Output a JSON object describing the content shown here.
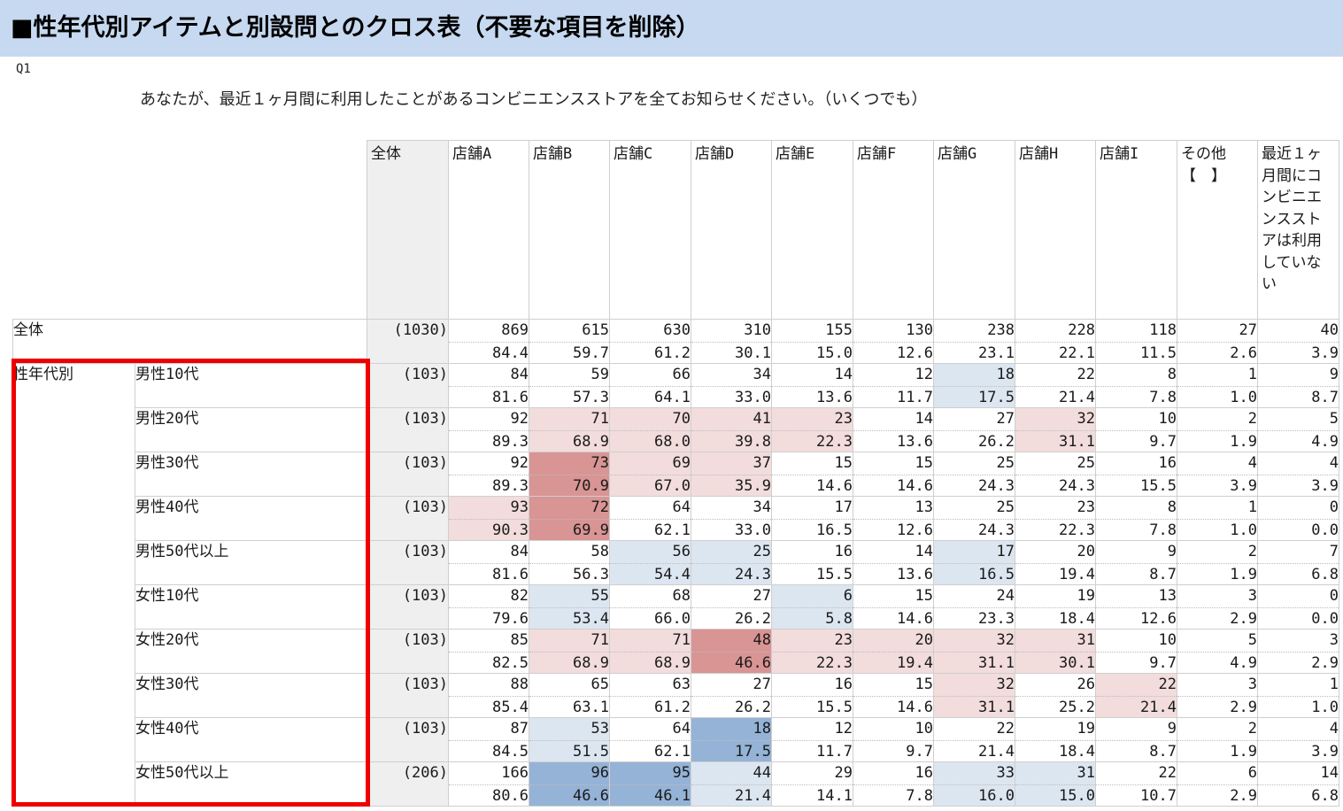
{
  "title": "■性年代別アイテムと別設問とのクロス表（不要な項目を削除）",
  "question_id": "Q1",
  "question_text": "あなたが、最近１ヶ月間に利用したことがあるコンビニエンスストアを全てお知らせください。（いくつでも）",
  "columns": [
    "全体",
    "店舗A",
    "店舗B",
    "店舗C",
    "店舗D",
    "店舗E",
    "店舗F",
    "店舗G",
    "店舗H",
    "店舗I",
    "その他【　】",
    "最近１ヶ月間にコンビニエンスストアは利用していない"
  ],
  "colors": {
    "title_bg": "#c6d9f0",
    "n_bg": "#efefef",
    "highlight_frame": "#ee0000",
    "r1": "#f2dcdc",
    "r2": "#d99494",
    "b1": "#dce6f1",
    "b2": "#95b3d7"
  },
  "rows": [
    {
      "group": "全体",
      "label": "",
      "n": "(1030)",
      "counts": [
        "869",
        "615",
        "630",
        "310",
        "155",
        "130",
        "238",
        "228",
        "118",
        "27",
        "40"
      ],
      "pcts": [
        "84.4",
        "59.7",
        "61.2",
        "30.1",
        "15.0",
        "12.6",
        "23.1",
        "22.1",
        "11.5",
        "2.6",
        "3.9"
      ],
      "shade": [
        "",
        "",
        "",
        "",
        "",
        "",
        "",
        "",
        "",
        "",
        ""
      ]
    },
    {
      "group": "性年代別",
      "label": "男性10代",
      "n": "(103)",
      "counts": [
        "84",
        "59",
        "66",
        "34",
        "14",
        "12",
        "18",
        "22",
        "8",
        "1",
        "9"
      ],
      "pcts": [
        "81.6",
        "57.3",
        "64.1",
        "33.0",
        "13.6",
        "11.7",
        "17.5",
        "21.4",
        "7.8",
        "1.0",
        "8.7"
      ],
      "shade": [
        "",
        "",
        "",
        "",
        "",
        "",
        "b1",
        "",
        "",
        "",
        ""
      ]
    },
    {
      "group": "",
      "label": "男性20代",
      "n": "(103)",
      "counts": [
        "92",
        "71",
        "70",
        "41",
        "23",
        "14",
        "27",
        "32",
        "10",
        "2",
        "5"
      ],
      "pcts": [
        "89.3",
        "68.9",
        "68.0",
        "39.8",
        "22.3",
        "13.6",
        "26.2",
        "31.1",
        "9.7",
        "1.9",
        "4.9"
      ],
      "shade": [
        "",
        "r1",
        "r1",
        "r1",
        "r1",
        "",
        "",
        "r1",
        "",
        "",
        ""
      ]
    },
    {
      "group": "",
      "label": "男性30代",
      "n": "(103)",
      "counts": [
        "92",
        "73",
        "69",
        "37",
        "15",
        "15",
        "25",
        "25",
        "16",
        "4",
        "4"
      ],
      "pcts": [
        "89.3",
        "70.9",
        "67.0",
        "35.9",
        "14.6",
        "14.6",
        "24.3",
        "24.3",
        "15.5",
        "3.9",
        "3.9"
      ],
      "shade": [
        "",
        "r2",
        "r1",
        "r1",
        "",
        "",
        "",
        "",
        "",
        "",
        ""
      ]
    },
    {
      "group": "",
      "label": "男性40代",
      "n": "(103)",
      "counts": [
        "93",
        "72",
        "64",
        "34",
        "17",
        "13",
        "25",
        "23",
        "8",
        "1",
        "0"
      ],
      "pcts": [
        "90.3",
        "69.9",
        "62.1",
        "33.0",
        "16.5",
        "12.6",
        "24.3",
        "22.3",
        "7.8",
        "1.0",
        "0.0"
      ],
      "shade": [
        "r1",
        "r2",
        "",
        "",
        "",
        "",
        "",
        "",
        "",
        "",
        ""
      ]
    },
    {
      "group": "",
      "label": "男性50代以上",
      "n": "(103)",
      "counts": [
        "84",
        "58",
        "56",
        "25",
        "16",
        "14",
        "17",
        "20",
        "9",
        "2",
        "7"
      ],
      "pcts": [
        "81.6",
        "56.3",
        "54.4",
        "24.3",
        "15.5",
        "13.6",
        "16.5",
        "19.4",
        "8.7",
        "1.9",
        "6.8"
      ],
      "shade": [
        "",
        "",
        "b1",
        "b1",
        "",
        "",
        "b1",
        "",
        "",
        "",
        ""
      ]
    },
    {
      "group": "",
      "label": "女性10代",
      "n": "(103)",
      "counts": [
        "82",
        "55",
        "68",
        "27",
        "6",
        "15",
        "24",
        "19",
        "13",
        "3",
        "0"
      ],
      "pcts": [
        "79.6",
        "53.4",
        "66.0",
        "26.2",
        "5.8",
        "14.6",
        "23.3",
        "18.4",
        "12.6",
        "2.9",
        "0.0"
      ],
      "shade": [
        "",
        "b1",
        "",
        "",
        "b1",
        "",
        "",
        "",
        "",
        "",
        ""
      ]
    },
    {
      "group": "",
      "label": "女性20代",
      "n": "(103)",
      "counts": [
        "85",
        "71",
        "71",
        "48",
        "23",
        "20",
        "32",
        "31",
        "10",
        "5",
        "3"
      ],
      "pcts": [
        "82.5",
        "68.9",
        "68.9",
        "46.6",
        "22.3",
        "19.4",
        "31.1",
        "30.1",
        "9.7",
        "4.9",
        "2.9"
      ],
      "shade": [
        "",
        "r1",
        "r1",
        "r2",
        "r1",
        "r1",
        "r1",
        "r1",
        "",
        "",
        ""
      ]
    },
    {
      "group": "",
      "label": "女性30代",
      "n": "(103)",
      "counts": [
        "88",
        "65",
        "63",
        "27",
        "16",
        "15",
        "32",
        "26",
        "22",
        "3",
        "1"
      ],
      "pcts": [
        "85.4",
        "63.1",
        "61.2",
        "26.2",
        "15.5",
        "14.6",
        "31.1",
        "25.2",
        "21.4",
        "2.9",
        "1.0"
      ],
      "shade": [
        "",
        "",
        "",
        "",
        "",
        "",
        "r1",
        "",
        "r1",
        "",
        ""
      ]
    },
    {
      "group": "",
      "label": "女性40代",
      "n": "(103)",
      "counts": [
        "87",
        "53",
        "64",
        "18",
        "12",
        "10",
        "22",
        "19",
        "9",
        "2",
        "4"
      ],
      "pcts": [
        "84.5",
        "51.5",
        "62.1",
        "17.5",
        "11.7",
        "9.7",
        "21.4",
        "18.4",
        "8.7",
        "1.9",
        "3.9"
      ],
      "shade": [
        "",
        "b1",
        "",
        "b2",
        "",
        "",
        "",
        "",
        "",
        "",
        ""
      ]
    },
    {
      "group": "",
      "label": "女性50代以上",
      "n": "(206)",
      "counts": [
        "166",
        "96",
        "95",
        "44",
        "29",
        "16",
        "33",
        "31",
        "22",
        "6",
        "14"
      ],
      "pcts": [
        "80.6",
        "46.6",
        "46.1",
        "21.4",
        "14.1",
        "7.8",
        "16.0",
        "15.0",
        "10.7",
        "2.9",
        "6.8"
      ],
      "shade": [
        "",
        "b2",
        "b2",
        "b1",
        "",
        "",
        "b1",
        "b1",
        "",
        "",
        ""
      ]
    }
  ]
}
